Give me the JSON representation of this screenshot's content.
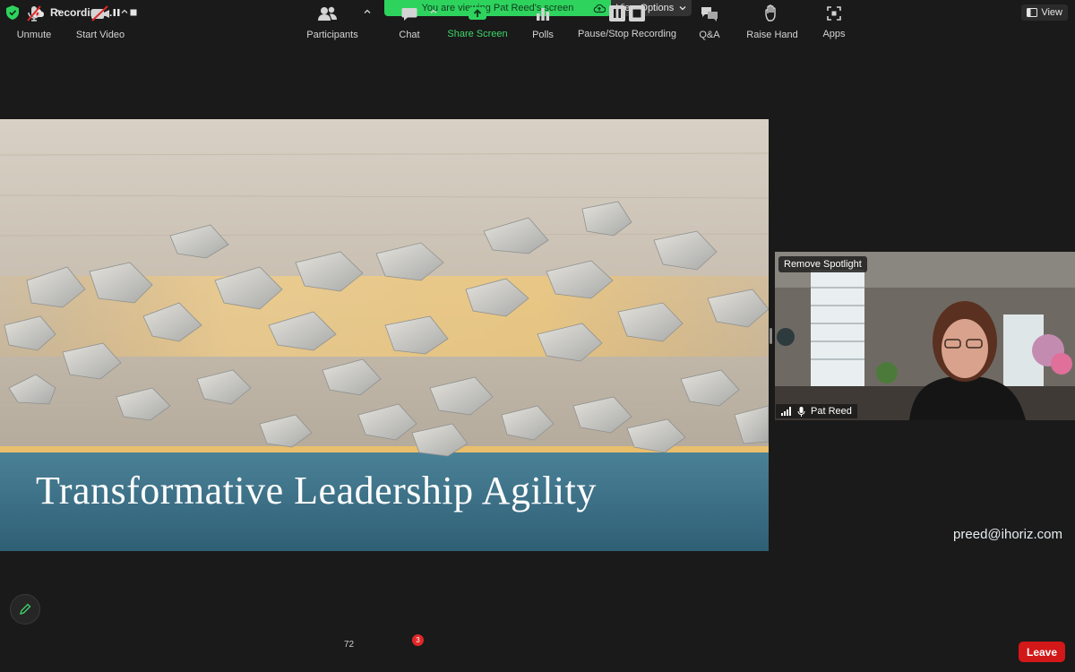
{
  "colors": {
    "accent_green": "#2ed35e",
    "leave_red": "#d21818",
    "background": "#1a1a1a"
  },
  "topbar": {
    "recording_label": "Recording...",
    "viewing_banner": "You are viewing Pat Reed's screen",
    "view_options_label": "View Options",
    "view_label": "View",
    "icons": [
      "shield-icon",
      "cloud-recording-icon",
      "pause-icon",
      "stop-icon",
      "cloud-upload-icon",
      "chevron-down-icon",
      "view-layout-icon"
    ]
  },
  "slide": {
    "title": "Transformative Leadership Agility",
    "email": "preed@ihoriz.com"
  },
  "participant": {
    "spotlight_label": "Remove Spotlight",
    "name": "Pat Reed"
  },
  "toolbar": {
    "unmute": "Unmute",
    "start_video": "Start Video",
    "participants": "Participants",
    "participants_count": "72",
    "chat": "Chat",
    "chat_badge": "3",
    "share_screen": "Share Screen",
    "polls": "Polls",
    "pause_stop_recording": "Pause/Stop Recording",
    "qa": "Q&A",
    "raise_hand": "Raise Hand",
    "apps": "Apps",
    "leave": "Leave"
  }
}
